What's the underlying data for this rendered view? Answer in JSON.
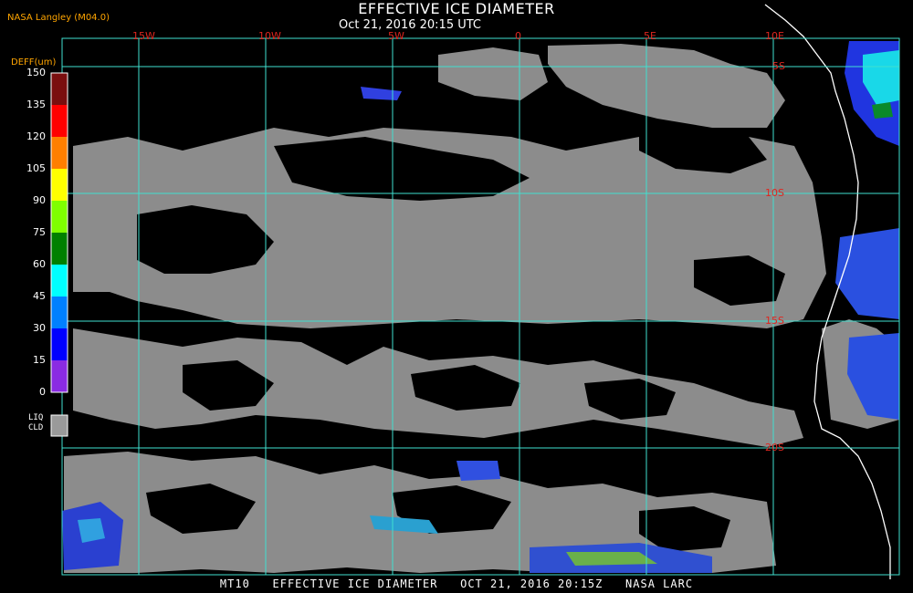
{
  "header": {
    "title": "EFFECTIVE ICE DIAMETER",
    "subtitle": "Oct 21, 2016 20:15 UTC",
    "credit": "NASA Langley (M04.0)"
  },
  "legend": {
    "title": "DEFF(um)",
    "ticks": [
      "150",
      "135",
      "120",
      "105",
      "90",
      "75",
      "60",
      "45",
      "30",
      "15",
      "0"
    ],
    "colors": [
      "#7a0e0e",
      "#ff0000",
      "#ff7f00",
      "#ffff00",
      "#7fff00",
      "#008000",
      "#00ffff",
      "#0080ff",
      "#0000ff",
      "#8a2be2"
    ],
    "liq_label_1": "LIQ",
    "liq_label_2": "CLD",
    "liq_color": "#9a9a9a"
  },
  "map": {
    "lon_labels": [
      "15W",
      "10W",
      "5W",
      "0",
      "5E",
      "10E"
    ],
    "lat_labels": [
      "5S",
      "10S",
      "15S",
      "20S"
    ],
    "gridline_color": "#40e0d0",
    "cloud_color": "#8c8c8c",
    "coast_color": "#ffffff"
  },
  "footer": {
    "text": "MT10   EFFECTIVE ICE DIAMETER   OCT 21, 2016 20:15Z   NASA LARC"
  }
}
